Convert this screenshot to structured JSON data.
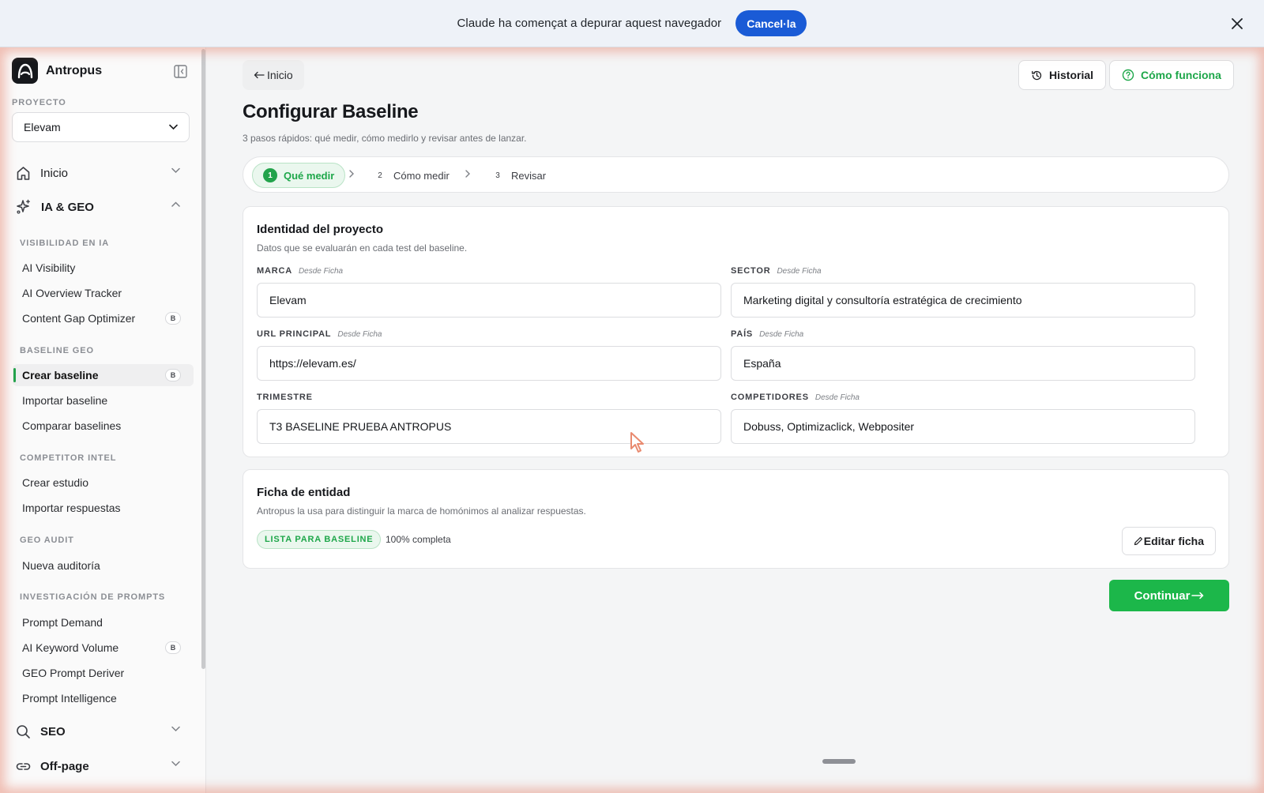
{
  "debug_bar": {
    "message": "Claude ha començat a depurar aquest navegador",
    "cancel_label": "Cancel·la"
  },
  "sidebar": {
    "brand": "Antropus",
    "project_label": "PROYECTO",
    "project_value": "Elevam",
    "groups": {
      "inicio": "Inicio",
      "ia_geo": "IA & GEO",
      "seo": "SEO",
      "offpage": "Off-page"
    },
    "sections": {
      "visibilidad": "VISIBILIDAD EN IA",
      "baseline": "BASELINE GEO",
      "competitor": "COMPETITOR INTEL",
      "audit": "GEO AUDIT",
      "prompts": "INVESTIGACIÓN DE PROMPTS"
    },
    "items": {
      "ai_visibility": "AI Visibility",
      "ai_overview": "AI Overview Tracker",
      "content_gap": "Content Gap Optimizer",
      "crear_baseline": "Crear baseline",
      "importar_baseline": "Importar baseline",
      "comparar_baselines": "Comparar baselines",
      "crear_estudio": "Crear estudio",
      "importar_respuestas": "Importar respuestas",
      "nueva_auditoria": "Nueva auditoría",
      "prompt_demand": "Prompt Demand",
      "ai_keyword_volume": "AI Keyword Volume",
      "geo_prompt_deriver": "GEO Prompt Deriver",
      "prompt_intelligence": "Prompt Intelligence"
    },
    "badge": "B"
  },
  "header": {
    "back_label": "Inicio",
    "historial_label": "Historial",
    "como_funciona_label": "Cómo funciona"
  },
  "page": {
    "title": "Configurar Baseline",
    "subtitle": "3 pasos rápidos: qué medir, cómo medirlo y revisar antes de lanzar."
  },
  "steps": [
    {
      "num": "1",
      "label": "Qué medir"
    },
    {
      "num": "2",
      "label": "Cómo medir"
    },
    {
      "num": "3",
      "label": "Revisar"
    }
  ],
  "identity_card": {
    "title": "Identidad del proyecto",
    "subtitle": "Datos que se evaluarán en cada test del baseline.",
    "source_tag": "Desde Ficha",
    "fields": {
      "marca": {
        "label": "MARCA",
        "value": "Elevam"
      },
      "sector": {
        "label": "SECTOR",
        "value": "Marketing digital y consultoría estratégica de crecimiento"
      },
      "url": {
        "label": "URL PRINCIPAL",
        "value": "https://elevam.es/"
      },
      "pais": {
        "label": "PAÍS",
        "value": "España"
      },
      "trimestre": {
        "label": "TRIMESTRE",
        "value": "T3 BASELINE PRUEBA ANTROPUS"
      },
      "competidores": {
        "label": "COMPETIDORES",
        "value": "Dobuss, Optimizaclick, Webpositer"
      }
    }
  },
  "entity_card": {
    "title": "Ficha de entidad",
    "subtitle": "Antropus la usa para distinguir la marca de homónimos al analizar respuestas.",
    "status": "LISTA PARA BASELINE",
    "completeness": "100% completa",
    "edit_label": "Editar ficha"
  },
  "continue_label": "Continuar",
  "colors": {
    "accent_green": "#1cb74a",
    "banner_blue": "#1a5bd6"
  }
}
